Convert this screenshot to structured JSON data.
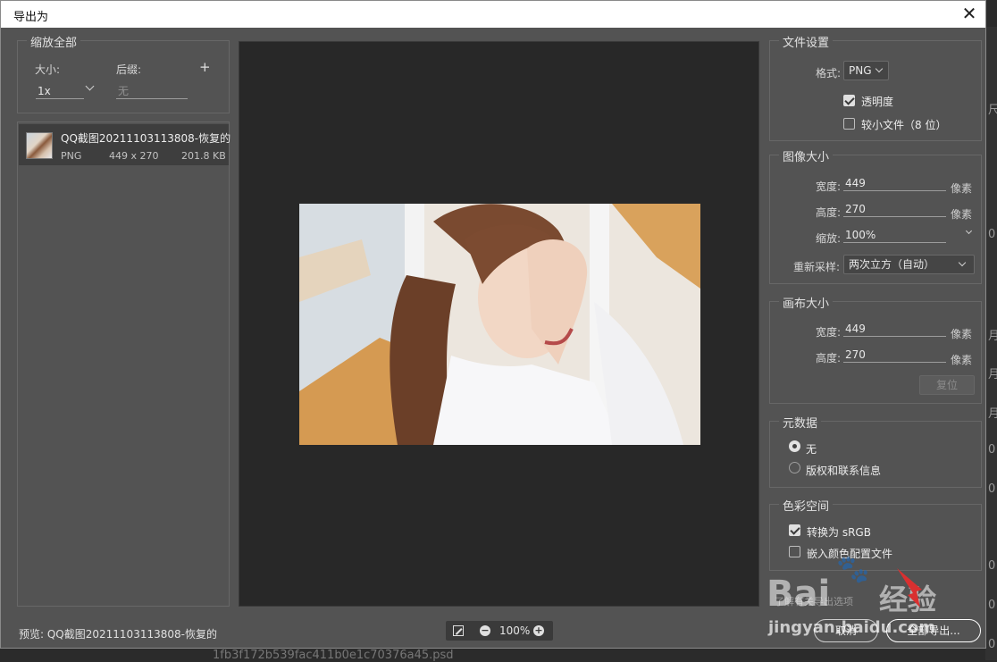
{
  "dialog": {
    "title": "导出为"
  },
  "left": {
    "group_title": "缩放全部",
    "size_label": "大小:",
    "size_value": "1x",
    "suffix_label": "后缀:",
    "suffix_placeholder": "无",
    "add_symbol": "+"
  },
  "file": {
    "name": "QQ截图20211103113808-恢复的",
    "format": "PNG",
    "dimensions": "449 x 270",
    "size": "201.8 KB"
  },
  "preview": {
    "label": "预览: QQ截图20211103113808-恢复的",
    "zoom": "100%"
  },
  "file_settings": {
    "title": "文件设置",
    "format_label": "格式:",
    "format_value": "PNG",
    "transparency_label": "透明度",
    "transparency_checked": true,
    "smaller_file_label": "较小文件（8 位）",
    "smaller_file_checked": false
  },
  "image_size": {
    "title": "图像大小",
    "width_label": "宽度:",
    "width_value": "449",
    "height_label": "高度:",
    "height_value": "270",
    "unit": "像素",
    "scale_label": "缩放:",
    "scale_value": "100%",
    "resample_label": "重新采样:",
    "resample_value": "两次立方（自动）"
  },
  "canvas_size": {
    "title": "画布大小",
    "width_label": "宽度:",
    "width_value": "449",
    "height_label": "高度:",
    "height_value": "270",
    "unit": "像素",
    "reset_label": "复位"
  },
  "metadata": {
    "title": "元数据",
    "option_none": "无",
    "option_copyright": "版权和联系信息",
    "selected": "无"
  },
  "color_space": {
    "title": "色彩空间",
    "convert_srgb": "转换为 sRGB",
    "convert_checked": true,
    "embed_profile": "嵌入颜色配置文件",
    "embed_checked": false
  },
  "footer": {
    "hint": "了解有关导出选项",
    "cancel": "取消",
    "export_all": "全部导出..."
  },
  "background": {
    "right_chars": [
      "尺",
      "0",
      "月",
      "月",
      "月",
      "0",
      "0",
      "0",
      "0",
      "0"
    ],
    "bottom_text": "1fb3f172b539fac411b0e1c70376a45.psd"
  },
  "watermark": {
    "brand": "Bai",
    "brand_cn": "经验",
    "url": "jingyan.baidu.com"
  }
}
